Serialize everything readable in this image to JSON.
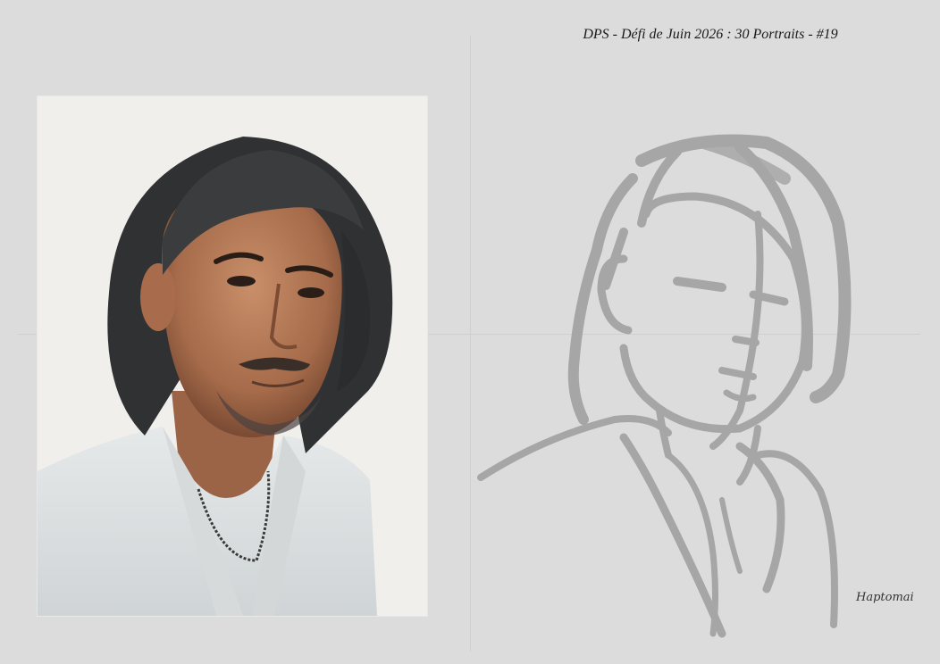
{
  "header": {
    "title": "DPS - Défi de Juin 2026 : 30 Portraits - #19"
  },
  "photo": {
    "icon": "portrait-photo"
  },
  "sketch": {
    "icon": "portrait-sketch"
  },
  "signature": {
    "text": "Haptomai"
  },
  "colors": {
    "background": "#dcdcdc",
    "sketch_stroke": "#a9a9a9",
    "photo_background": "#f2f1ef"
  }
}
